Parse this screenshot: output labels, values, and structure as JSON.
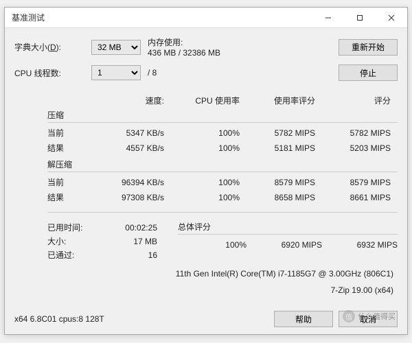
{
  "window": {
    "title": "基准测试"
  },
  "top": {
    "dict_label_pre": "字典大小(",
    "dict_label_u": "D",
    "dict_label_post": "):",
    "dict_value": "32 MB",
    "mem_label": "内存使用:",
    "mem_value": "436 MB / 32386 MB",
    "restart": "重新开始",
    "threads_label": "CPU 线程数:",
    "threads_value": "1",
    "threads_of": "/ 8",
    "stop": "停止"
  },
  "headers": {
    "speed": "速度:",
    "cpu": "CPU 使用率",
    "rate": "使用率评分",
    "score": "评分"
  },
  "compress": {
    "title": "压缩",
    "cur_label": "当前",
    "cur": {
      "speed": "5347 KB/s",
      "cpu": "100%",
      "rate": "5782 MIPS",
      "score": "5782 MIPS"
    },
    "res_label": "结果",
    "res": {
      "speed": "4557 KB/s",
      "cpu": "100%",
      "rate": "5181 MIPS",
      "score": "5203 MIPS"
    }
  },
  "decompress": {
    "title": "解压缩",
    "cur_label": "当前",
    "cur": {
      "speed": "96394 KB/s",
      "cpu": "100%",
      "rate": "8579 MIPS",
      "score": "8579 MIPS"
    },
    "res_label": "结果",
    "res": {
      "speed": "97308 KB/s",
      "cpu": "100%",
      "rate": "8658 MIPS",
      "score": "8661 MIPS"
    }
  },
  "info": {
    "elapsed_label": "已用时间:",
    "elapsed": "00:02:25",
    "size_label": "大小:",
    "size": "17 MB",
    "passes_label": "已通过:",
    "passes": "16",
    "overall_label": "总体评分",
    "overall": {
      "cpu": "100%",
      "score1": "6920 MIPS",
      "score2": "6932 MIPS"
    }
  },
  "cpu_line": "11th Gen Intel(R) Core(TM) i7-1185G7 @ 3.00GHz (806C1)",
  "ver_line": "7-Zip 19.00  (x64)",
  "build": "x64 6.8C01 cpus:8 128T",
  "buttons": {
    "help": "帮助",
    "cancel": "取消"
  },
  "watermark": {
    "badge": "值",
    "text": "什么值得买"
  }
}
